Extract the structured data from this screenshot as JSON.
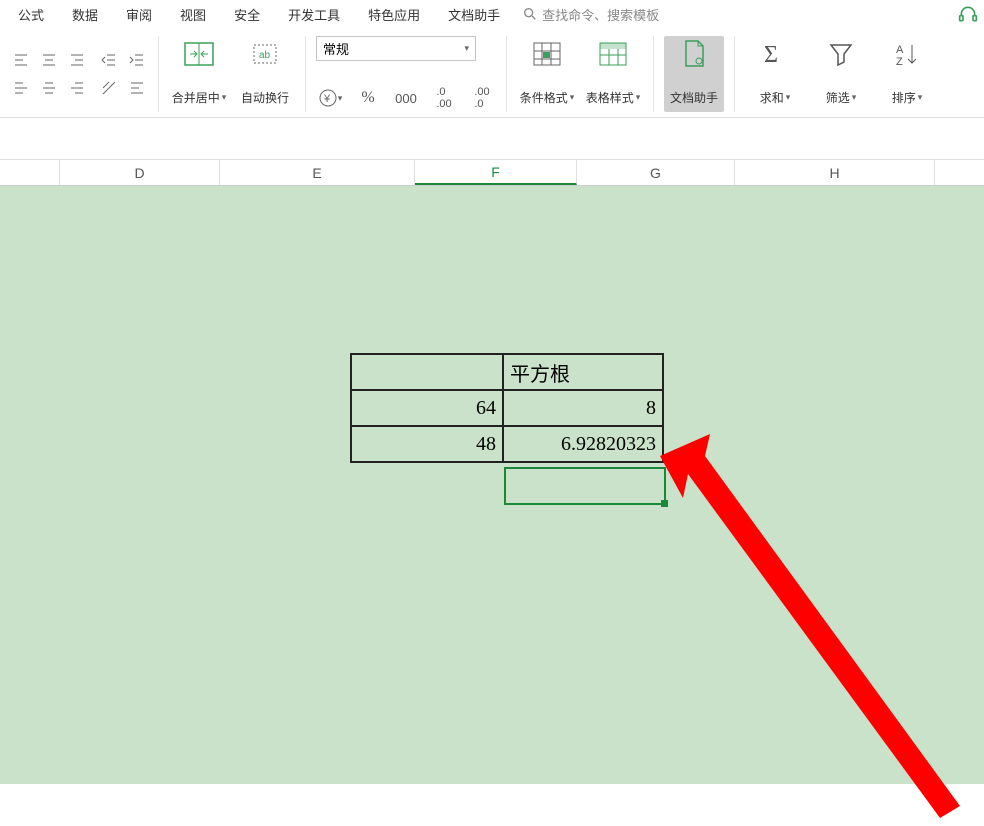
{
  "menu": {
    "items": [
      "公式",
      "数据",
      "审阅",
      "视图",
      "安全",
      "开发工具",
      "特色应用",
      "文档助手"
    ],
    "search_placeholder": "查找命令、搜索模板"
  },
  "ribbon": {
    "merge_label": "合并居中",
    "wrap_label": "自动换行",
    "format_name": "常规",
    "cond_fmt": "条件格式",
    "table_style": "表格样式",
    "doc_helper": "文档助手",
    "sum": "求和",
    "filter": "筛选",
    "sort": "排序"
  },
  "columns": {
    "D": "D",
    "E": "E",
    "F": "F",
    "G": "G",
    "H": "H"
  },
  "table": {
    "header_f": "平方根",
    "r1_e": "64",
    "r1_f": "8",
    "r2_e": "48",
    "r2_f": "6.92820323"
  }
}
